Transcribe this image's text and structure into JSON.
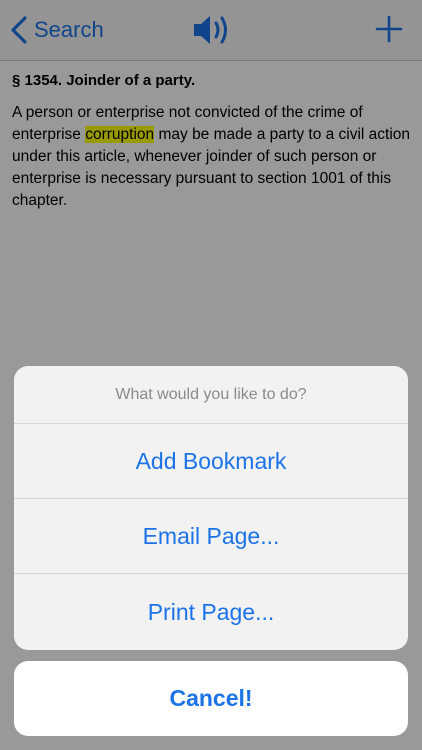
{
  "navbar": {
    "back_label": "Search",
    "back_icon": "chevron-left-icon",
    "speaker_icon": "speaker-icon",
    "add_icon": "plus-icon",
    "accent_color": "#1c73e8"
  },
  "document": {
    "title": "§ 1354. Joinder of a party.",
    "body_before": "A person or enterprise not convicted of the crime of enterprise ",
    "highlighted_term": "corruption",
    "body_after": " may be made a party to a civil action under this article, whenever joinder of such person or enterprise is necessary pursuant to section 1001 of this chapter.",
    "highlight_color": "#ffff00"
  },
  "action_sheet": {
    "prompt": "What would you like to do?",
    "items": [
      {
        "label": "Add Bookmark"
      },
      {
        "label": "Email Page..."
      },
      {
        "label": "Print Page..."
      }
    ],
    "cancel_label": "Cancel!"
  }
}
